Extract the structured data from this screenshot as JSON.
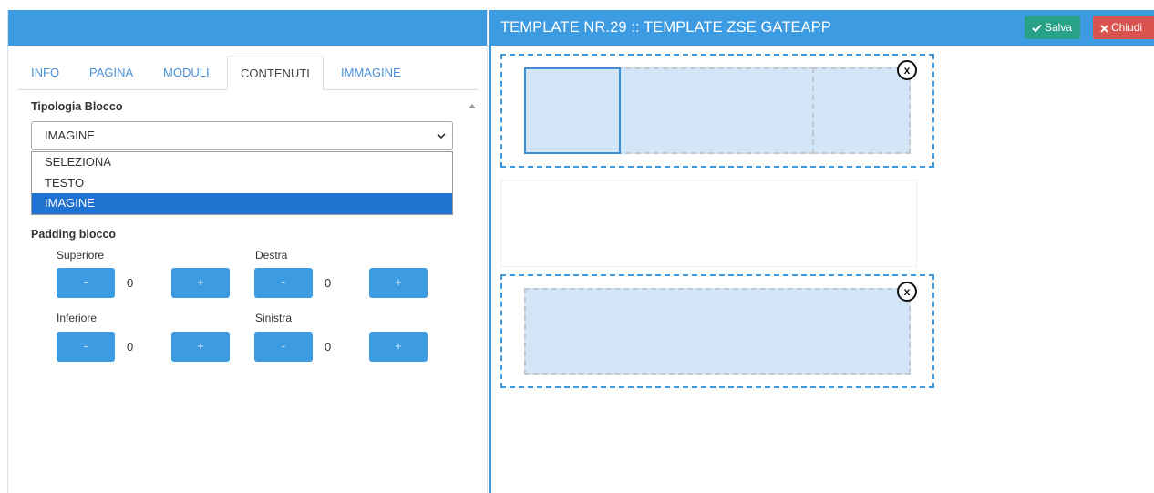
{
  "tabs": [
    {
      "label": "INFO",
      "active": false
    },
    {
      "label": "PAGINA",
      "active": false
    },
    {
      "label": "MODULI",
      "active": false
    },
    {
      "label": "CONTENUTI",
      "active": true
    },
    {
      "label": "IMMAGINE",
      "active": false
    }
  ],
  "block_type": {
    "label": "Tipologia Blocco",
    "selected_value": "IMAGINE",
    "options": [
      "SELEZIONA",
      "TESTO",
      "IMAGINE"
    ],
    "highlighted_option": "IMAGINE"
  },
  "padding": {
    "title": "Padding blocco",
    "top": {
      "label": "Superiore",
      "value": "0"
    },
    "right": {
      "label": "Destra",
      "value": "0"
    },
    "bottom": {
      "label": "Inferiore",
      "value": "0"
    },
    "left": {
      "label": "Sinistra",
      "value": "0"
    },
    "minus_label": "-",
    "plus_label": "+"
  },
  "editor": {
    "title": "TEMPLATE NR.29 :: TEMPLATE ZSE GATEAPP",
    "save_label": "Salva",
    "close_label": "Chiudi",
    "remove_label": "x"
  },
  "colors": {
    "primary": "#3d9be1",
    "save": "#27a187",
    "close": "#d9534f",
    "selection": "#1f72d0"
  }
}
